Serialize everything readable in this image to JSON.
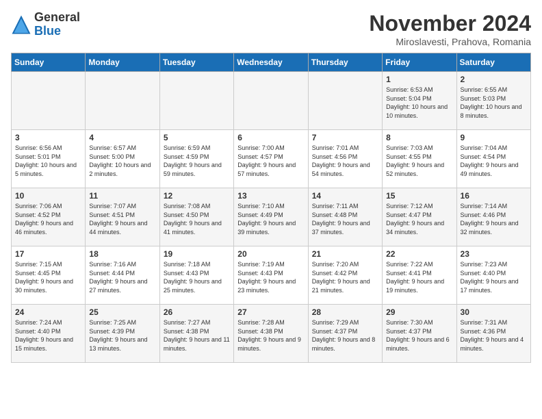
{
  "header": {
    "logo_line1": "General",
    "logo_line2": "Blue",
    "month": "November 2024",
    "location": "Miroslavesti, Prahova, Romania"
  },
  "weekdays": [
    "Sunday",
    "Monday",
    "Tuesday",
    "Wednesday",
    "Thursday",
    "Friday",
    "Saturday"
  ],
  "weeks": [
    [
      {
        "day": "",
        "info": ""
      },
      {
        "day": "",
        "info": ""
      },
      {
        "day": "",
        "info": ""
      },
      {
        "day": "",
        "info": ""
      },
      {
        "day": "",
        "info": ""
      },
      {
        "day": "1",
        "info": "Sunrise: 6:53 AM\nSunset: 5:04 PM\nDaylight: 10 hours and 10 minutes."
      },
      {
        "day": "2",
        "info": "Sunrise: 6:55 AM\nSunset: 5:03 PM\nDaylight: 10 hours and 8 minutes."
      }
    ],
    [
      {
        "day": "3",
        "info": "Sunrise: 6:56 AM\nSunset: 5:01 PM\nDaylight: 10 hours and 5 minutes."
      },
      {
        "day": "4",
        "info": "Sunrise: 6:57 AM\nSunset: 5:00 PM\nDaylight: 10 hours and 2 minutes."
      },
      {
        "day": "5",
        "info": "Sunrise: 6:59 AM\nSunset: 4:59 PM\nDaylight: 9 hours and 59 minutes."
      },
      {
        "day": "6",
        "info": "Sunrise: 7:00 AM\nSunset: 4:57 PM\nDaylight: 9 hours and 57 minutes."
      },
      {
        "day": "7",
        "info": "Sunrise: 7:01 AM\nSunset: 4:56 PM\nDaylight: 9 hours and 54 minutes."
      },
      {
        "day": "8",
        "info": "Sunrise: 7:03 AM\nSunset: 4:55 PM\nDaylight: 9 hours and 52 minutes."
      },
      {
        "day": "9",
        "info": "Sunrise: 7:04 AM\nSunset: 4:54 PM\nDaylight: 9 hours and 49 minutes."
      }
    ],
    [
      {
        "day": "10",
        "info": "Sunrise: 7:06 AM\nSunset: 4:52 PM\nDaylight: 9 hours and 46 minutes."
      },
      {
        "day": "11",
        "info": "Sunrise: 7:07 AM\nSunset: 4:51 PM\nDaylight: 9 hours and 44 minutes."
      },
      {
        "day": "12",
        "info": "Sunrise: 7:08 AM\nSunset: 4:50 PM\nDaylight: 9 hours and 41 minutes."
      },
      {
        "day": "13",
        "info": "Sunrise: 7:10 AM\nSunset: 4:49 PM\nDaylight: 9 hours and 39 minutes."
      },
      {
        "day": "14",
        "info": "Sunrise: 7:11 AM\nSunset: 4:48 PM\nDaylight: 9 hours and 37 minutes."
      },
      {
        "day": "15",
        "info": "Sunrise: 7:12 AM\nSunset: 4:47 PM\nDaylight: 9 hours and 34 minutes."
      },
      {
        "day": "16",
        "info": "Sunrise: 7:14 AM\nSunset: 4:46 PM\nDaylight: 9 hours and 32 minutes."
      }
    ],
    [
      {
        "day": "17",
        "info": "Sunrise: 7:15 AM\nSunset: 4:45 PM\nDaylight: 9 hours and 30 minutes."
      },
      {
        "day": "18",
        "info": "Sunrise: 7:16 AM\nSunset: 4:44 PM\nDaylight: 9 hours and 27 minutes."
      },
      {
        "day": "19",
        "info": "Sunrise: 7:18 AM\nSunset: 4:43 PM\nDaylight: 9 hours and 25 minutes."
      },
      {
        "day": "20",
        "info": "Sunrise: 7:19 AM\nSunset: 4:43 PM\nDaylight: 9 hours and 23 minutes."
      },
      {
        "day": "21",
        "info": "Sunrise: 7:20 AM\nSunset: 4:42 PM\nDaylight: 9 hours and 21 minutes."
      },
      {
        "day": "22",
        "info": "Sunrise: 7:22 AM\nSunset: 4:41 PM\nDaylight: 9 hours and 19 minutes."
      },
      {
        "day": "23",
        "info": "Sunrise: 7:23 AM\nSunset: 4:40 PM\nDaylight: 9 hours and 17 minutes."
      }
    ],
    [
      {
        "day": "24",
        "info": "Sunrise: 7:24 AM\nSunset: 4:40 PM\nDaylight: 9 hours and 15 minutes."
      },
      {
        "day": "25",
        "info": "Sunrise: 7:25 AM\nSunset: 4:39 PM\nDaylight: 9 hours and 13 minutes."
      },
      {
        "day": "26",
        "info": "Sunrise: 7:27 AM\nSunset: 4:38 PM\nDaylight: 9 hours and 11 minutes."
      },
      {
        "day": "27",
        "info": "Sunrise: 7:28 AM\nSunset: 4:38 PM\nDaylight: 9 hours and 9 minutes."
      },
      {
        "day": "28",
        "info": "Sunrise: 7:29 AM\nSunset: 4:37 PM\nDaylight: 9 hours and 8 minutes."
      },
      {
        "day": "29",
        "info": "Sunrise: 7:30 AM\nSunset: 4:37 PM\nDaylight: 9 hours and 6 minutes."
      },
      {
        "day": "30",
        "info": "Sunrise: 7:31 AM\nSunset: 4:36 PM\nDaylight: 9 hours and 4 minutes."
      }
    ]
  ]
}
